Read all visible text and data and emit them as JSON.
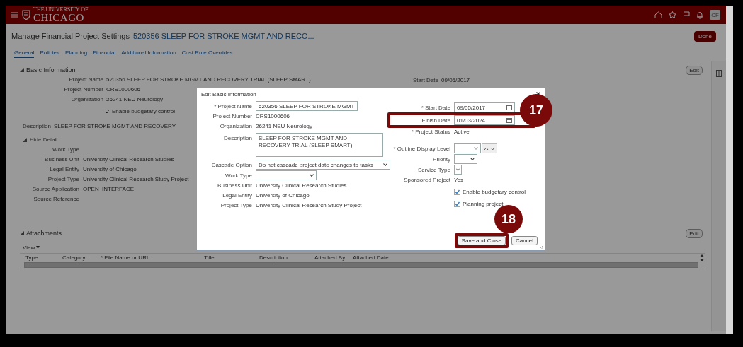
{
  "header": {
    "logo_top": "THE UNIVERSITY OF",
    "logo": "CHICAGO",
    "user_initials": "CF"
  },
  "page": {
    "title": "Manage Financial Project Settings",
    "project": "520356 SLEEP FOR STROKE MGMT AND RECO...",
    "done": "Done"
  },
  "tabs": [
    {
      "label": "General",
      "selected": true
    },
    {
      "label": "Policies",
      "selected": false
    },
    {
      "label": "Planning",
      "selected": false
    },
    {
      "label": "Financial",
      "selected": false
    },
    {
      "label": "Additional Information",
      "selected": false
    },
    {
      "label": "Cost Rule Overrides",
      "selected": false
    }
  ],
  "basic_information": {
    "heading": "Basic Information",
    "expanded": true,
    "edit": "Edit",
    "fields": [
      {
        "label": "Project Name",
        "value": "520356 SLEEP FOR STROKE MGMT AND RECOVERY TRIAL (SLEEP SMART)"
      },
      {
        "label": "Project Number",
        "value": "CRS1000606"
      },
      {
        "label": "Organization",
        "value": "26241 NEU Neurology"
      }
    ],
    "start_date": {
      "label": "Start Date",
      "value": "09/05/2017"
    },
    "budgetary_control": {
      "label": "Enable budgetary control",
      "checked": true
    },
    "description": {
      "label": "Description",
      "value": "SLEEP FOR STROKE MGMT AND RECOVERY"
    },
    "detail": {
      "toggle": "Hide Detail",
      "expanded": true,
      "fields": [
        {
          "label": "Work Type"
        },
        {
          "label": "Business Unit",
          "value": "University Clinical Research Studies"
        },
        {
          "label": "Legal Entity",
          "value": "University of Chicago"
        },
        {
          "label": "Project Type",
          "value": "University Clinical Research Study Project"
        },
        {
          "label": "Source Application",
          "value": "OPEN_INTERFACE"
        },
        {
          "label": "Source Reference"
        }
      ]
    }
  },
  "attachments": {
    "heading": "Attachments",
    "expanded": true,
    "view_menu": "View",
    "actions": "Edit",
    "columns": [
      {
        "label": "Type"
      },
      {
        "label": "Category"
      },
      {
        "label": "* File Name or URL"
      },
      {
        "label": "Title"
      },
      {
        "label": "Description"
      },
      {
        "label": "Attached By"
      },
      {
        "label": "Attached Date"
      }
    ]
  },
  "dialog": {
    "title": "Edit Basic Information",
    "left": [
      {
        "kind": "input",
        "label": "* Project Name",
        "value": "520356 SLEEP FOR STROKE MGMT"
      },
      {
        "kind": "text",
        "label": "Project Number",
        "value": "CRS1000606"
      },
      {
        "kind": "text",
        "label": "Organization",
        "value": "26241 NEU Neurology"
      },
      {
        "kind": "textarea",
        "label": "Description",
        "value": "SLEEP FOR STROKE MGMT AND RECOVERY TRIAL (SLEEP SMART)"
      },
      {
        "kind": "select",
        "label": "Cascade Option",
        "value": "Do not cascade project date changes to tasks"
      },
      {
        "kind": "select",
        "label": "Work Type"
      },
      {
        "kind": "text",
        "label": "Business Unit",
        "value": "University Clinical Research Studies"
      },
      {
        "kind": "text",
        "label": "Legal Entity",
        "value": "University of Chicago"
      },
      {
        "kind": "text",
        "label": "Project Type",
        "value": "University Clinical Research Study Project"
      }
    ],
    "right": [
      {
        "kind": "date",
        "label": "* Start Date",
        "value": "09/05/2017"
      },
      {
        "kind": "date",
        "label": "Finish Date",
        "value": "01/03/2024",
        "callout": "17"
      },
      {
        "kind": "text",
        "label": "* Project Status",
        "value": "Active"
      },
      {
        "kind": "spinner",
        "label": "* Outline Display Level"
      },
      {
        "kind": "select",
        "label": "Priority"
      },
      {
        "kind": "smallselect",
        "label": "Service Type"
      },
      {
        "kind": "text",
        "label": "Sponsored Project",
        "value": "Yes"
      },
      {
        "kind": "checkbox",
        "label": "Enable budgetary control",
        "checked": true
      },
      {
        "kind": "checkbox",
        "label": "Planning project",
        "checked": true
      }
    ],
    "buttons": [
      {
        "label": "Save and Close",
        "callout": "18"
      },
      {
        "label": "Cancel"
      }
    ]
  }
}
